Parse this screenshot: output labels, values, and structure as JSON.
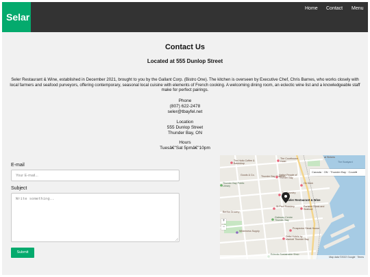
{
  "nav": {
    "logo": "Selar",
    "links": [
      "Home",
      "Contact",
      "Menu"
    ]
  },
  "header": {
    "title": "Contact Us",
    "subtitle": "Located at 555 Dunlop Street"
  },
  "intro": "Seler Restaurant & Wine, established in December 2021, brought to you by the Gallant Corp. (Bistro One). The kitchen is overseen by Executive Chef, Chris Barnes, who works closely with local farmers and seafood purveyors, offering contemporary, seasonal local cuisine with elements of French cooking. A welcoming dining room, an eclectic wine list and a knowledgeable staff make for perfect pairings.",
  "contact": {
    "phone_heading": "Phone",
    "phone": "(807) 622-2478",
    "email": "seler@tbayfel.net",
    "location_heading": "Location",
    "address": "555 Dunlop Street",
    "city": "Thunder Bay, ON",
    "hours_heading": "Hours",
    "hours": "Tuesâ€\"Sat 5pmâ€\"10pm"
  },
  "form": {
    "email_label": "E-mail",
    "email_placeholder": "Your E-mail...",
    "subject_label": "Subject",
    "subject_placeholder": "Write something..",
    "submit_label": "Submit"
  },
  "map": {
    "search_text": "Canada · ON · Thunder Bay · Count▾",
    "place_label": "Seler Restaurant & Wine",
    "labels": [
      "The Hoito Coffee & Bakeshop",
      "The Courthouse Hotel",
      "at Sinkers",
      "The Boatyard",
      "Thunder Bay Public Library",
      "Thunder Bay Museum",
      "Goods & Co.",
      "Native People of Thunder Bay",
      "On Deck",
      "The Foundry",
      "St Paul Roastery",
      "Portside Steak & Seafood",
      "Bertha Grocery",
      "Gateway Centre Thunder Bay",
      "Wilderness Supply",
      "Prospector Steak House",
      "Delta Hotels by Marriott Thunder Bay",
      "Eclectic Sustainable Shop"
    ],
    "attribution": "Map data ©2022 Google · Terms"
  },
  "colors": {
    "nav_bg": "#333333",
    "brand": "#04aa6d",
    "page_bg": "#f1f1f1",
    "water": "#a6cbe4",
    "park": "#c7e6c3"
  }
}
